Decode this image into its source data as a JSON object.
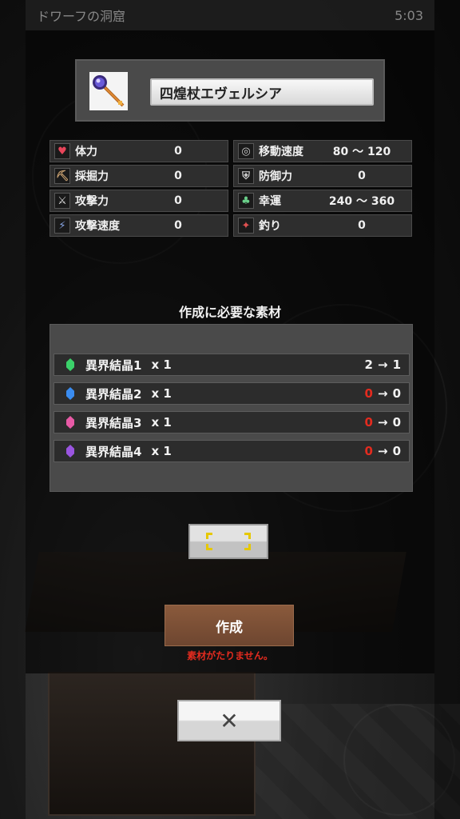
{
  "status_bar": {
    "location": "ドワーフの洞窟",
    "time": "5:03"
  },
  "item": {
    "name": "四煌杖エヴェルシア",
    "icon": "staff-icon"
  },
  "stats": [
    {
      "label": "体力",
      "value": "0",
      "icon": "heart-icon"
    },
    {
      "label": "移動速度",
      "value": "80 ～ 120",
      "icon": "speed-icon"
    },
    {
      "label": "採掘力",
      "value": "0",
      "icon": "pickaxe-icon"
    },
    {
      "label": "防御力",
      "value": "0",
      "icon": "shield-icon"
    },
    {
      "label": "攻撃力",
      "value": "0",
      "icon": "sword-icon"
    },
    {
      "label": "幸運",
      "value": "240 ～ 360",
      "icon": "clover-icon"
    },
    {
      "label": "攻撃速度",
      "value": "0",
      "icon": "runner-icon"
    },
    {
      "label": "釣り",
      "value": "0",
      "icon": "fish-icon"
    }
  ],
  "materials_title": "作成に必要な素材",
  "materials": [
    {
      "name": "異界結晶1",
      "qty": "x 1",
      "have": "2",
      "arrow": "→",
      "after": "1",
      "gem_color": "#3bd16a"
    },
    {
      "name": "異界結晶2",
      "qty": "x 1",
      "have": "0",
      "arrow": "→",
      "after": "0",
      "gem_color": "#3a8cf0"
    },
    {
      "name": "異界結晶3",
      "qty": "x 1",
      "have": "0",
      "arrow": "→",
      "after": "0",
      "gem_color": "#e85aa6"
    },
    {
      "name": "異界結晶4",
      "qty": "x 1",
      "have": "0",
      "arrow": "→",
      "after": "0",
      "gem_color": "#9a55e0"
    }
  ],
  "create_button": "作成",
  "error_message": "素材がたりません。",
  "close_button": "✕"
}
